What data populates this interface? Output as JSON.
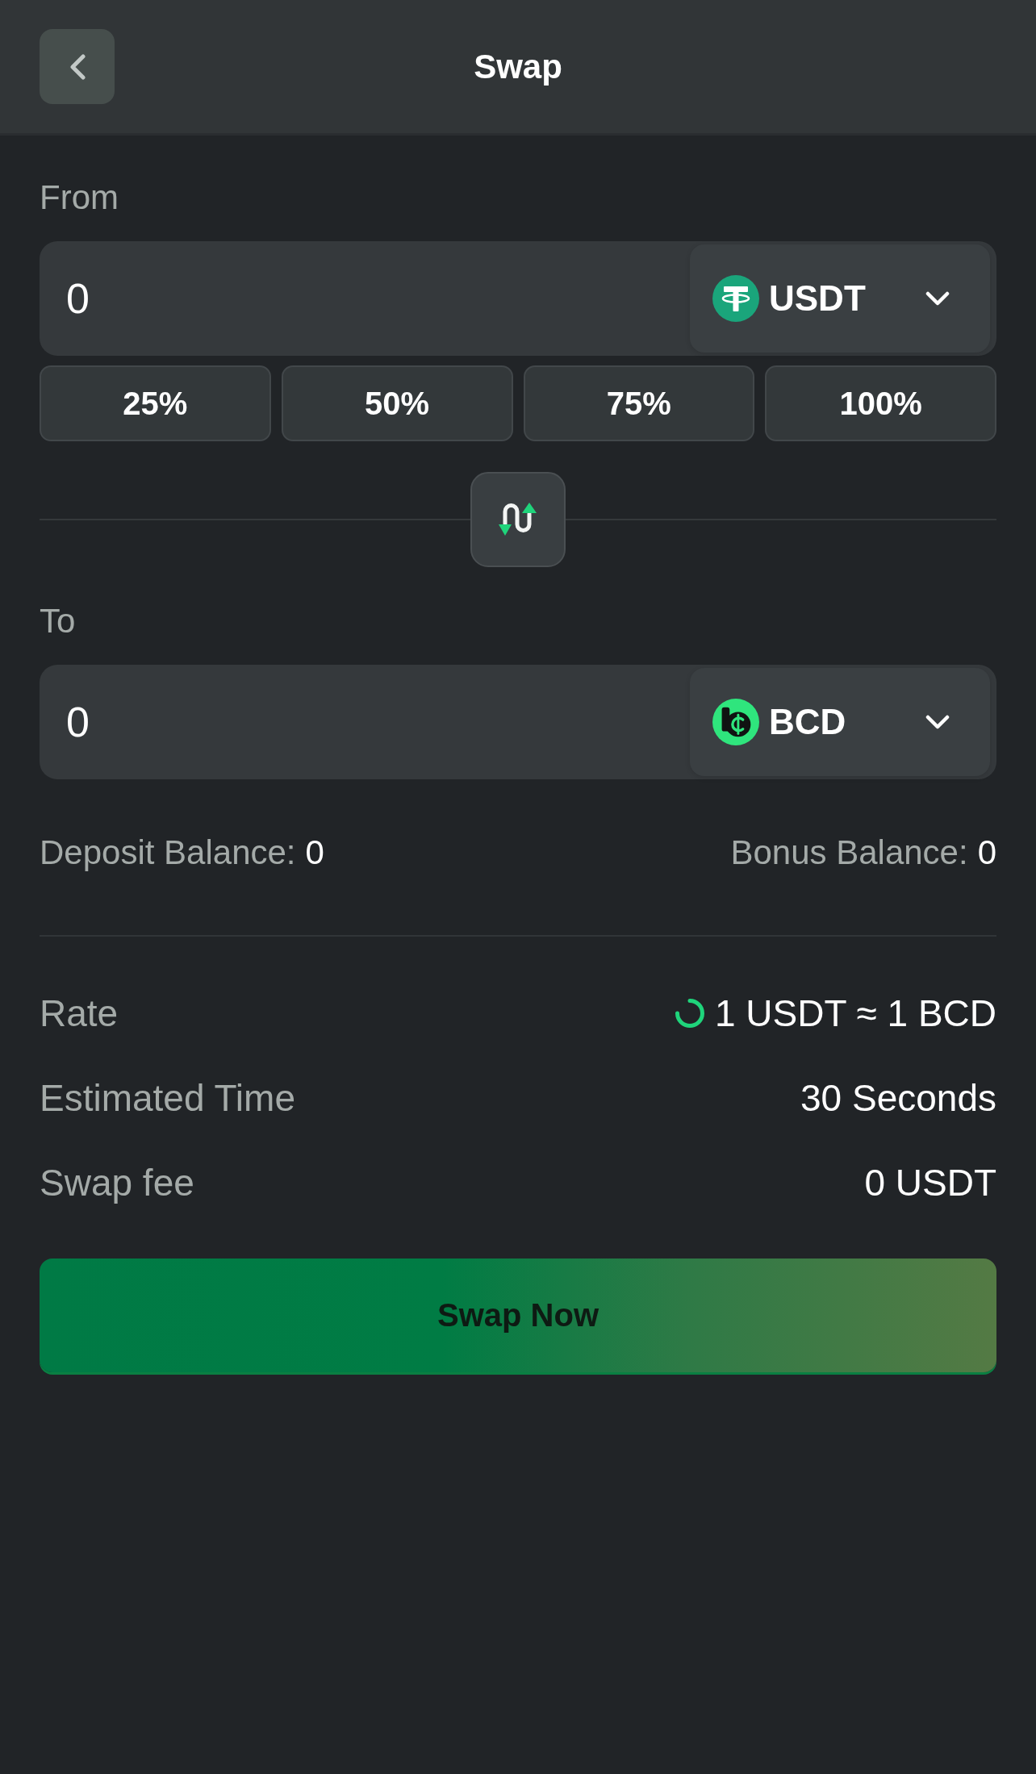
{
  "header": {
    "title": "Swap"
  },
  "from": {
    "label": "From",
    "amount": "0",
    "token": "USDT"
  },
  "percent_buttons": [
    "25%",
    "50%",
    "75%",
    "100%"
  ],
  "to": {
    "label": "To",
    "amount": "0",
    "token": "BCD"
  },
  "balances": [
    {
      "label": "Deposit Balance:",
      "value": "0"
    },
    {
      "label": "Bonus Balance:",
      "value": "0"
    }
  ],
  "details": [
    {
      "label": "Rate",
      "value": "1 USDT ≈ 1 BCD",
      "refreshing": true
    },
    {
      "label": "Estimated Time",
      "value": "30 Seconds",
      "refreshing": false
    },
    {
      "label": "Swap fee",
      "value": "0 USDT",
      "refreshing": false
    }
  ],
  "submit": {
    "label": "Swap Now"
  }
}
